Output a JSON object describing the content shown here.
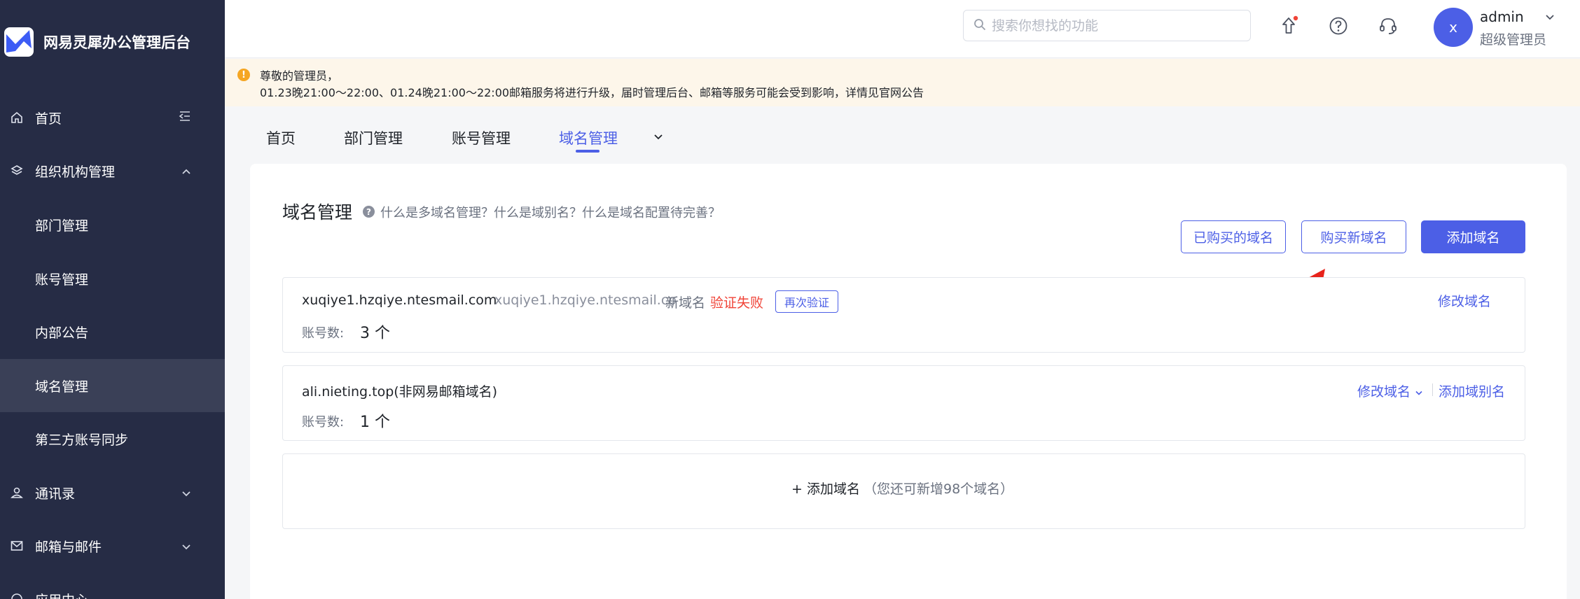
{
  "app": {
    "name": "网易灵犀办公管理后台"
  },
  "sidebar": {
    "items": [
      {
        "label": "首页",
        "icon": "home-icon"
      },
      {
        "label": "组织机构管理",
        "icon": "layers-icon"
      },
      {
        "label": "部门管理"
      },
      {
        "label": "账号管理"
      },
      {
        "label": "内部公告"
      },
      {
        "label": "域名管理"
      },
      {
        "label": "第三方账号同步"
      },
      {
        "label": "通讯录",
        "icon": "user-icon"
      },
      {
        "label": "邮箱与邮件",
        "icon": "mail-icon"
      },
      {
        "label": "应用中心",
        "icon": "app-icon"
      }
    ]
  },
  "header": {
    "search_placeholder": "搜索你想找的功能",
    "user": {
      "avatar_letter": "x",
      "name": "admin",
      "role": "超级管理员"
    }
  },
  "notice": {
    "line1": "尊敬的管理员，",
    "line2": "01.23晚21:00～22:00、01.24晚21:00～22:00邮箱服务将进行升级，届时管理后台、邮箱等服务可能会受到影响，详情见官网公告"
  },
  "tabs": [
    {
      "label": "首页"
    },
    {
      "label": "部门管理"
    },
    {
      "label": "账号管理"
    },
    {
      "label": "域名管理",
      "active": true
    }
  ],
  "main": {
    "title": "域名管理",
    "help_text": "什么是多域名管理？什么是域别名？什么是域名配置待完善？",
    "buttons": {
      "purchased": "已购买的域名",
      "buy_new": "购买新域名",
      "add": "添加域名"
    },
    "domains": [
      {
        "name": "xuqiye1.hzqiye.ntesmail.com",
        "alias": "xuqiye1.hzqiye.ntesmail.co",
        "type": "新域名",
        "status": "验证失败",
        "reverify_label": "再次验证",
        "count_label": "账号数:",
        "count_value": "3 个",
        "action": "修改域名"
      },
      {
        "name": "ali.nieting.top(非网易邮箱域名)",
        "count_label": "账号数:",
        "count_value": "1 个",
        "action": "修改域名",
        "action2": "添加域别名"
      }
    ],
    "add_row": {
      "label": "+ 添加域名",
      "hint": "（您还可新增98个域名）"
    }
  },
  "colors": {
    "sidebar_bg": "#262c45",
    "accent": "#4c5fe6",
    "error": "#f04438",
    "notice_bg": "#fdf6ea"
  }
}
